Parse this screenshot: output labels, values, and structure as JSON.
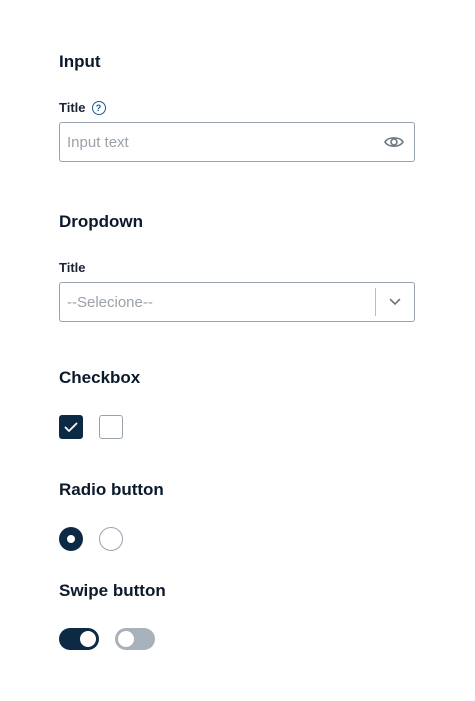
{
  "input_section": {
    "heading": "Input",
    "field_label": "Title",
    "help_icon": "question-circle-icon",
    "placeholder": "Input text",
    "value": "",
    "trailing_icon": "eye-icon"
  },
  "dropdown_section": {
    "heading": "Dropdown",
    "field_label": "Title",
    "selected_value": "--Selecione--",
    "trailing_icon": "chevron-down-icon"
  },
  "checkbox_section": {
    "heading": "Checkbox",
    "items": [
      {
        "checked": true
      },
      {
        "checked": false
      }
    ]
  },
  "radio_section": {
    "heading": "Radio button",
    "items": [
      {
        "selected": true
      },
      {
        "selected": false
      }
    ]
  },
  "swipe_section": {
    "heading": "Swipe button",
    "items": [
      {
        "on": true
      },
      {
        "on": false
      }
    ]
  },
  "colors": {
    "primary": "#0d2a45",
    "border": "#9aa3ad",
    "help_icon": "#1d5b8f",
    "toggle_off": "#a7b1bc",
    "placeholder": "#9aa1a9"
  }
}
